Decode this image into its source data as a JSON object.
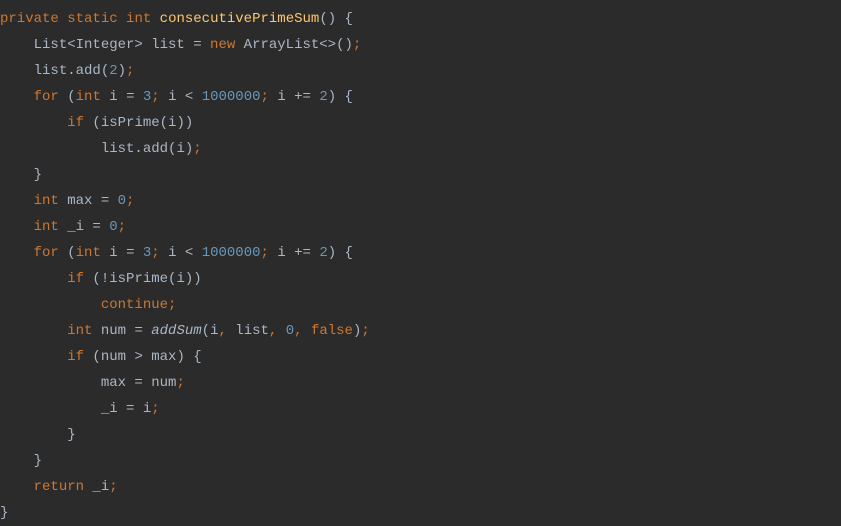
{
  "code": {
    "lines": [
      {
        "indent": 0,
        "tokens": [
          {
            "t": "private",
            "c": "kw"
          },
          {
            "t": " ",
            "c": "ident"
          },
          {
            "t": "static",
            "c": "kw"
          },
          {
            "t": " ",
            "c": "ident"
          },
          {
            "t": "int",
            "c": "kw"
          },
          {
            "t": " ",
            "c": "ident"
          },
          {
            "t": "consecutivePrimeSum",
            "c": "method-name"
          },
          {
            "t": "() {",
            "c": "ident"
          }
        ]
      },
      {
        "indent": 4,
        "tokens": [
          {
            "t": "List<Integer> list = ",
            "c": "ident"
          },
          {
            "t": "new",
            "c": "kw"
          },
          {
            "t": " ArrayList<>()",
            "c": "ident"
          },
          {
            "t": ";",
            "c": "semicolon"
          }
        ]
      },
      {
        "indent": 4,
        "tokens": [
          {
            "t": "list.add(",
            "c": "ident"
          },
          {
            "t": "2",
            "c": "num"
          },
          {
            "t": ")",
            "c": "ident"
          },
          {
            "t": ";",
            "c": "semicolon"
          }
        ]
      },
      {
        "indent": 4,
        "tokens": [
          {
            "t": "for",
            "c": "kw"
          },
          {
            "t": " (",
            "c": "ident"
          },
          {
            "t": "int",
            "c": "kw"
          },
          {
            "t": " i = ",
            "c": "ident"
          },
          {
            "t": "3",
            "c": "num"
          },
          {
            "t": ";",
            "c": "semicolon"
          },
          {
            "t": " i < ",
            "c": "ident"
          },
          {
            "t": "1000000",
            "c": "num"
          },
          {
            "t": ";",
            "c": "semicolon"
          },
          {
            "t": " i += ",
            "c": "ident"
          },
          {
            "t": "2",
            "c": "num"
          },
          {
            "t": ") {",
            "c": "ident"
          }
        ]
      },
      {
        "indent": 8,
        "tokens": [
          {
            "t": "if",
            "c": "kw"
          },
          {
            "t": " (isPrime(i))",
            "c": "ident"
          }
        ]
      },
      {
        "indent": 12,
        "tokens": [
          {
            "t": "list.add(i)",
            "c": "ident"
          },
          {
            "t": ";",
            "c": "semicolon"
          }
        ]
      },
      {
        "indent": 4,
        "tokens": [
          {
            "t": "}",
            "c": "ident"
          }
        ]
      },
      {
        "indent": 4,
        "tokens": [
          {
            "t": "int",
            "c": "kw"
          },
          {
            "t": " max = ",
            "c": "ident"
          },
          {
            "t": "0",
            "c": "num"
          },
          {
            "t": ";",
            "c": "semicolon"
          }
        ]
      },
      {
        "indent": 4,
        "tokens": [
          {
            "t": "int",
            "c": "kw"
          },
          {
            "t": " _i = ",
            "c": "ident"
          },
          {
            "t": "0",
            "c": "num"
          },
          {
            "t": ";",
            "c": "semicolon"
          }
        ]
      },
      {
        "indent": 4,
        "tokens": [
          {
            "t": "for",
            "c": "kw"
          },
          {
            "t": " (",
            "c": "ident"
          },
          {
            "t": "int",
            "c": "kw"
          },
          {
            "t": " i = ",
            "c": "ident"
          },
          {
            "t": "3",
            "c": "num"
          },
          {
            "t": ";",
            "c": "semicolon"
          },
          {
            "t": " i < ",
            "c": "ident"
          },
          {
            "t": "1000000",
            "c": "num"
          },
          {
            "t": ";",
            "c": "semicolon"
          },
          {
            "t": " i += ",
            "c": "ident"
          },
          {
            "t": "2",
            "c": "num"
          },
          {
            "t": ") {",
            "c": "ident"
          }
        ]
      },
      {
        "indent": 8,
        "tokens": [
          {
            "t": "if",
            "c": "kw"
          },
          {
            "t": " (!isPrime(i))",
            "c": "ident"
          }
        ]
      },
      {
        "indent": 12,
        "tokens": [
          {
            "t": "continue;",
            "c": "kw"
          }
        ]
      },
      {
        "indent": 8,
        "tokens": [
          {
            "t": "int",
            "c": "kw"
          },
          {
            "t": " num = ",
            "c": "ident"
          },
          {
            "t": "addSum",
            "c": "static-call"
          },
          {
            "t": "(i",
            "c": "ident"
          },
          {
            "t": ",",
            "c": "semicolon"
          },
          {
            "t": " list",
            "c": "ident"
          },
          {
            "t": ",",
            "c": "semicolon"
          },
          {
            "t": " ",
            "c": "ident"
          },
          {
            "t": "0",
            "c": "num"
          },
          {
            "t": ",",
            "c": "semicolon"
          },
          {
            "t": " ",
            "c": "ident"
          },
          {
            "t": "false",
            "c": "kw"
          },
          {
            "t": ")",
            "c": "ident"
          },
          {
            "t": ";",
            "c": "semicolon"
          }
        ]
      },
      {
        "indent": 8,
        "tokens": [
          {
            "t": "if",
            "c": "kw"
          },
          {
            "t": " (num > max) {",
            "c": "ident"
          }
        ]
      },
      {
        "indent": 12,
        "tokens": [
          {
            "t": "max = num",
            "c": "ident"
          },
          {
            "t": ";",
            "c": "semicolon"
          }
        ]
      },
      {
        "indent": 12,
        "tokens": [
          {
            "t": "_i = i",
            "c": "ident"
          },
          {
            "t": ";",
            "c": "semicolon"
          }
        ]
      },
      {
        "indent": 8,
        "tokens": [
          {
            "t": "}",
            "c": "ident"
          }
        ]
      },
      {
        "indent": 4,
        "tokens": [
          {
            "t": "}",
            "c": "ident"
          }
        ]
      },
      {
        "indent": 4,
        "tokens": [
          {
            "t": "return",
            "c": "kw"
          },
          {
            "t": " _i",
            "c": "ident"
          },
          {
            "t": ";",
            "c": "semicolon"
          }
        ]
      },
      {
        "indent": 0,
        "tokens": [
          {
            "t": "}",
            "c": "ident"
          }
        ]
      }
    ]
  }
}
